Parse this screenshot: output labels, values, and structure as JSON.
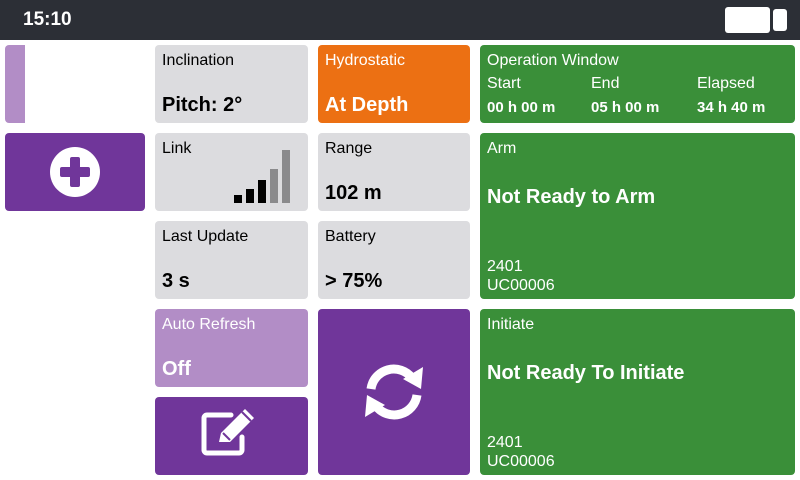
{
  "status_bar": {
    "time": "15:10"
  },
  "device": {
    "id": "2401",
    "code": "UC00006"
  },
  "tiles": {
    "inclination": {
      "label": "Inclination",
      "value": "Pitch: 2°"
    },
    "hydrostatic": {
      "label": "Hydrostatic",
      "value": "At Depth"
    },
    "link": {
      "label": "Link",
      "signal_bars": 5,
      "active_bars": 3
    },
    "range": {
      "label": "Range",
      "value": "102 m"
    },
    "last_update": {
      "label": "Last Update",
      "value": "3 s"
    },
    "battery": {
      "label": "Battery",
      "value": "> 75%"
    },
    "auto_refresh": {
      "label": "Auto Refresh",
      "value": "Off"
    }
  },
  "operation_window": {
    "label": "Operation Window",
    "start_label": "Start",
    "end_label": "End",
    "elapsed_label": "Elapsed",
    "start_value": "00 h 00 m",
    "end_value": "05 h 00 m",
    "elapsed_value": "34 h 40 m"
  },
  "arm": {
    "label": "Arm",
    "status": "Not Ready to Arm",
    "device_id": "2401",
    "device_code": "UC00006"
  },
  "initiate": {
    "label": "Initiate",
    "status": "Not Ready To Initiate",
    "device_id": "2401",
    "device_code": "UC00006"
  },
  "icons": {
    "add": "plus-circle-icon",
    "edit": "edit-icon",
    "refresh": "refresh-icon",
    "signal": "signal-icon",
    "battery": "battery-icon"
  },
  "colors": {
    "purple": "#70369a",
    "lilac": "#b28dc6",
    "green": "#3a8f39",
    "orange": "#ec7013",
    "grey": "#dcdcdf",
    "status_bar": "#2c2f36"
  }
}
